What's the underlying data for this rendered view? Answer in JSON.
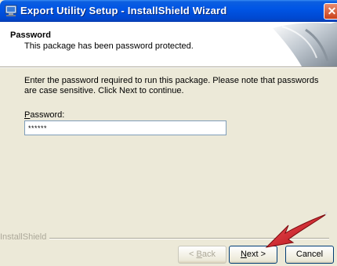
{
  "window": {
    "title": "Export Utility Setup - InstallShield Wizard",
    "close_symbol": "✕"
  },
  "header": {
    "title": "Password",
    "subtitle": "This package has been password protected."
  },
  "body": {
    "instructions": "Enter the password required to run this package.  Please note that passwords are case sensitive.  Click Next to continue.",
    "password_label_first": "P",
    "password_label_rest": "assword:",
    "password_value": "******"
  },
  "footer": {
    "brand": "InstallShield"
  },
  "buttons": {
    "back_first": "<",
    "back_hot": "B",
    "back_rest": "ack",
    "next_hot": "N",
    "next_rest": "ext >",
    "cancel": "Cancel"
  },
  "icons": [
    "setup-computer-icon",
    "close-icon",
    "header-graphic",
    "pointer-arrow"
  ],
  "colors": {
    "titlebar": "#0055e5",
    "close": "#c8411b",
    "face": "#ECE9D8",
    "arrow": "#d4141a"
  }
}
